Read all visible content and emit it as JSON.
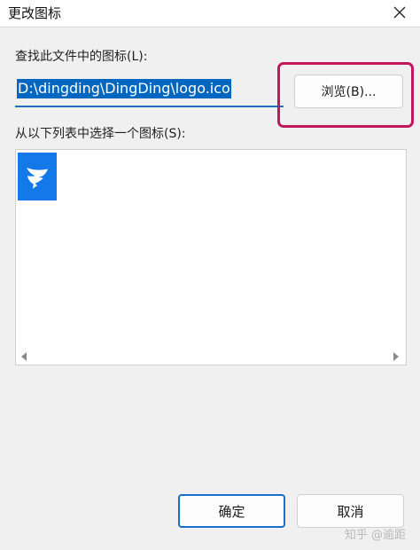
{
  "window": {
    "title": "更改图标",
    "close_icon": "close-icon"
  },
  "file_section": {
    "label": "查找此文件中的图标(L):",
    "path_value": "D:\\dingding\\DingDing\\logo.ico",
    "browse_label": "浏览(B)...",
    "highlight_color": "#c2185b"
  },
  "icon_section": {
    "label": "从以下列表中选择一个图标(S):",
    "icons": [
      {
        "name": "dingtalk-logo-icon",
        "selected": true
      }
    ]
  },
  "footer": {
    "ok_label": "确定",
    "cancel_label": "取消",
    "watermark": "知乎 @逾距"
  },
  "colors": {
    "selection": "#0067c0",
    "accent": "#1a6fc8",
    "icon_bg": "#1479e8"
  }
}
